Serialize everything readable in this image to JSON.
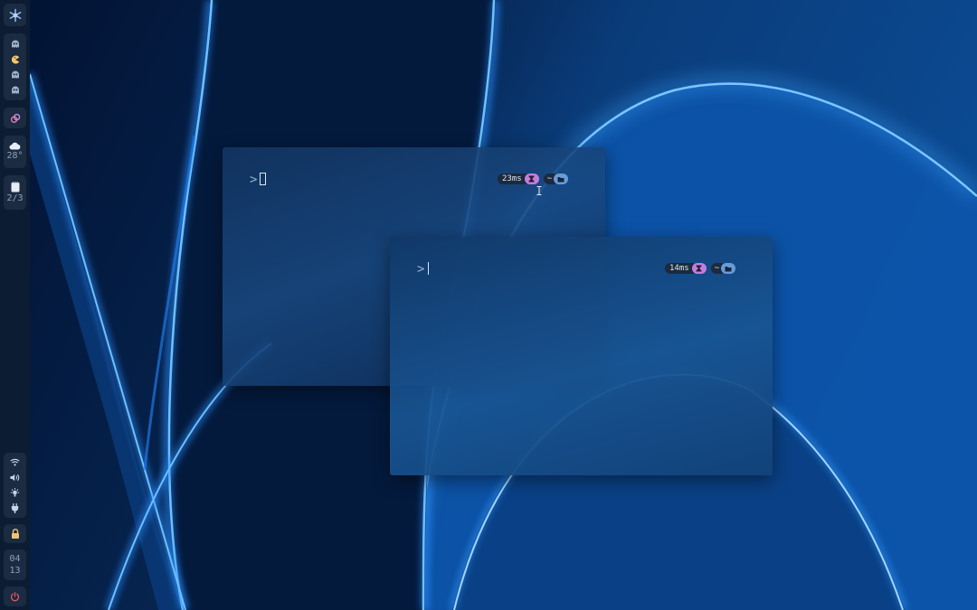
{
  "sidebar": {
    "logo_icon": "snowflake-icon",
    "workspaces": [
      {
        "icon": "ghost-icon",
        "active": false
      },
      {
        "icon": "pacman-icon",
        "active": true
      },
      {
        "icon": "ghost-icon",
        "active": false
      },
      {
        "icon": "ghost-icon",
        "active": false
      }
    ],
    "vpn_icon": "link-icon",
    "weather": {
      "icon": "cloud-icon",
      "temperature": "28°"
    },
    "notes": {
      "icon": "notepad-icon",
      "count": "2/3"
    },
    "system": {
      "icons": [
        "wifi-icon",
        "volume-icon",
        "brightness-icon",
        "plug-icon"
      ]
    },
    "lock_icon": "lock-icon",
    "clock": {
      "hour": "04",
      "minute": "13"
    },
    "power_icon": "power-icon"
  },
  "terminals": [
    {
      "prompt": ">",
      "duration": "23ms",
      "directory": "~",
      "cursor": "block"
    },
    {
      "prompt": ">",
      "duration": "14ms",
      "directory": "~",
      "cursor": "bar"
    }
  ],
  "colors": {
    "bar_bg": "#0c1d33",
    "module_bg": "#1a2b42",
    "pacman": "#f6c66b",
    "ghost": "#9db2cc",
    "hourglass_pill": "#c27ede",
    "folder_pill": "#6a9bd8",
    "power": "#e0555c"
  }
}
